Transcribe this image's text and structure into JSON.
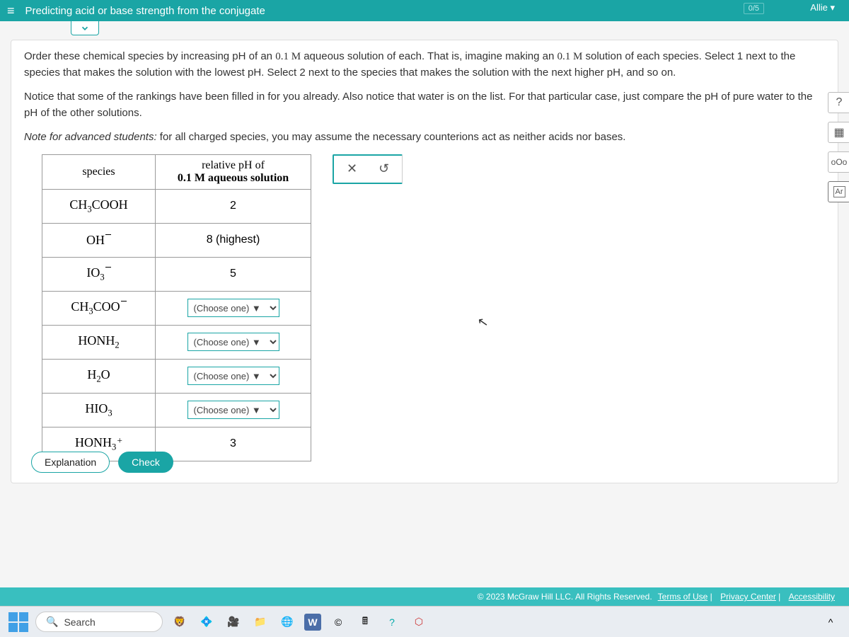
{
  "header": {
    "title": "Predicting acid or base strength from the conjugate",
    "progress": "0/5",
    "user": "Allie"
  },
  "instructions": {
    "p1a": "Order these chemical species by increasing pH of an ",
    "p1b": " aqueous solution of each. That is, imagine making an ",
    "p1c": " solution of each species. Select 1 next to the species that makes the solution with the lowest pH. Select 2 next to the species that makes the solution with the next higher pH, and so on.",
    "conc": "0.1 M",
    "p2": "Notice that some of the rankings have been filled in for you already. Also notice that water is on the list. For that particular case, just compare the pH of pure water to the pH of the other solutions.",
    "p3_label": "Note for advanced students:",
    "p3_text": " for all charged species, you may assume the necessary counterions act as neither acids nor bases."
  },
  "table": {
    "header_species": "species",
    "header_ph_a": "relative pH of",
    "header_ph_b": "0.1 M aqueous solution",
    "rows": [
      {
        "label_html": "CH<sub>3</sub>COOH",
        "value": "2",
        "type": "fixed"
      },
      {
        "label_html": "OH<span class='charge-line'></span>",
        "value": "8 (highest)",
        "type": "fixed"
      },
      {
        "label_html": "IO<sub>3</sub><span class='charge-line'></span>",
        "value": "5",
        "type": "fixed"
      },
      {
        "label_html": "CH<sub>3</sub>COO<span class='charge-line'></span>",
        "value": "(Choose one)",
        "type": "select"
      },
      {
        "label_html": "HONH<sub>2</sub>",
        "value": "(Choose one)",
        "type": "select"
      },
      {
        "label_html": "H<sub>2</sub>O",
        "value": "(Choose one)",
        "type": "select"
      },
      {
        "label_html": "HIO<sub>3</sub>",
        "value": "(Choose one)",
        "type": "select"
      },
      {
        "label_html": "HONH<sub>3</sub><span class='charge-plus'>+</span>",
        "value": "3",
        "type": "fixed"
      }
    ],
    "choose_placeholder": "(Choose one)"
  },
  "actions": {
    "clear": "✕",
    "reset": "↺"
  },
  "side": {
    "help": "?",
    "calc": "▦",
    "bars": "₀₀₀",
    "periodic": "Ar"
  },
  "footer": {
    "explanation": "Explanation",
    "check": "Check"
  },
  "copyright": {
    "text": "© 2023 McGraw Hill LLC. All Rights Reserved.",
    "terms": "Terms of Use",
    "privacy": "Privacy Center",
    "access": "Accessibility"
  },
  "taskbar": {
    "search": "Search"
  }
}
